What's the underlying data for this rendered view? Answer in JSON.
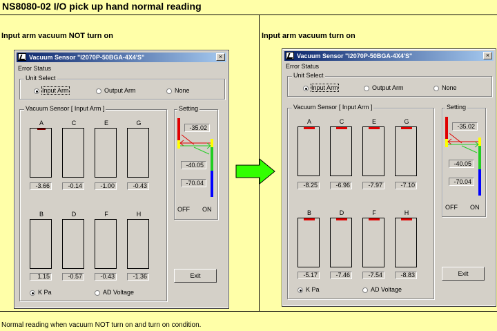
{
  "page_title": "NS8080-02 I/O pick up hand normal reading",
  "left_heading": "Input arm vacuum NOT turn on",
  "right_heading": "Input arm vacuum turn on",
  "footer": "Normal reading when vacuum NOT turn on and turn on condition.",
  "colors": {
    "background": "#ffffa8",
    "arrow": "#33ff00",
    "titlebar_start": "#0a246a",
    "titlebar_end": "#a6caf0",
    "red": "#e00000",
    "yellow": "#ffff00",
    "green": "#22cc22",
    "blue": "#0000ff"
  },
  "window": {
    "title": "Vacuum Sensor \"I2070P-50BGA-4X4'S\"",
    "close_glyph": "×",
    "error_status": "Error Status",
    "unit_select": "Unit Select",
    "unit_options": [
      "Input Arm",
      "Output Arm",
      "None"
    ],
    "sensor_group": "Vacuum Sensor [ Input Arm ]",
    "setting": "Setting",
    "off": "OFF",
    "on": "ON",
    "exit": "Exit",
    "unit_kpa": "K Pa",
    "unit_ad": "AD Voltage"
  },
  "left": {
    "sensors": [
      {
        "label": "A",
        "value": "-3.66"
      },
      {
        "label": "C",
        "value": "-0.14"
      },
      {
        "label": "E",
        "value": "-1.00"
      },
      {
        "label": "G",
        "value": "-0.43"
      },
      {
        "label": "B",
        "value": "1.15"
      },
      {
        "label": "D",
        "value": "-0.57"
      },
      {
        "label": "F",
        "value": "-0.43"
      },
      {
        "label": "H",
        "value": "-1.36"
      }
    ],
    "settings": [
      "-35.02",
      "-40.05",
      "-70.04"
    ]
  },
  "right": {
    "sensors": [
      {
        "label": "A",
        "value": "-8.25"
      },
      {
        "label": "C",
        "value": "-6.96"
      },
      {
        "label": "E",
        "value": "-7.97"
      },
      {
        "label": "G",
        "value": "-7.10"
      },
      {
        "label": "B",
        "value": "-5.17"
      },
      {
        "label": "D",
        "value": "-7.46"
      },
      {
        "label": "F",
        "value": "-7.54"
      },
      {
        "label": "H",
        "value": "-8.83"
      }
    ],
    "settings": [
      "-35.02",
      "-40.05",
      "-70.04"
    ]
  }
}
